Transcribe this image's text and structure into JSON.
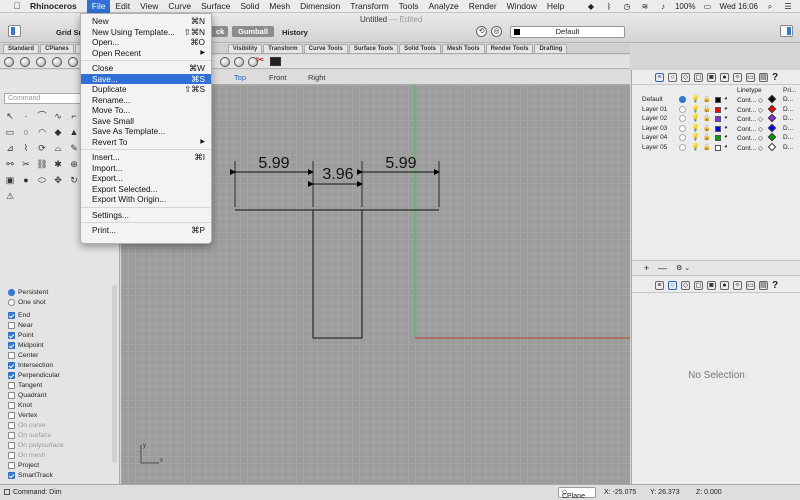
{
  "menubar": {
    "app": "Rhinoceros",
    "items": [
      "File",
      "Edit",
      "View",
      "Curve",
      "Surface",
      "Solid",
      "Mesh",
      "Dimension",
      "Transform",
      "Tools",
      "Analyze",
      "Render",
      "Window",
      "Help"
    ],
    "battery": "100%",
    "clock": "Wed 16:06"
  },
  "window": {
    "title": "Untitled",
    "edited": "— Edited",
    "grid_snap": "Grid Sn",
    "lock_label": "ck",
    "gumball": "Gumball",
    "history": "History",
    "layer": "Default"
  },
  "tabs": [
    "Standard",
    "CPlanes",
    "S",
    "Visibility",
    "Transform",
    "Curve Tools",
    "Surface Tools",
    "Solid Tools",
    "Mesh Tools",
    "Render Tools",
    "Drafting"
  ],
  "command": {
    "placeholder": "Command"
  },
  "viewport": {
    "tabs": [
      "Top",
      "Front",
      "Right"
    ],
    "active": "Top",
    "dimensions": [
      "5.99",
      "3.96",
      "5.99"
    ],
    "axis_y": "y",
    "axis_x": "x"
  },
  "file_menu": {
    "items": [
      {
        "label": "New",
        "shortcut": "⌘N"
      },
      {
        "label": "New Using Template...",
        "shortcut": "⇧⌘N"
      },
      {
        "label": "Open...",
        "shortcut": "⌘O"
      },
      {
        "label": "Open Recent",
        "submenu": "▶"
      },
      {
        "sep": true
      },
      {
        "label": "Close",
        "shortcut": "⌘W"
      },
      {
        "label": "Save...",
        "shortcut": "⌘S",
        "highlight": true
      },
      {
        "label": "Duplicate",
        "shortcut": "⇧⌘S"
      },
      {
        "label": "Rename..."
      },
      {
        "label": "Move To..."
      },
      {
        "label": "Save Small"
      },
      {
        "label": "Save As Template..."
      },
      {
        "label": "Revert To",
        "submenu": "▶"
      },
      {
        "sep": true
      },
      {
        "label": "Insert...",
        "shortcut": "⌘I"
      },
      {
        "label": "Import..."
      },
      {
        "label": "Export..."
      },
      {
        "label": "Export Selected..."
      },
      {
        "label": "Export With Origin..."
      },
      {
        "sep": true
      },
      {
        "label": "Settings..."
      },
      {
        "sep": true
      },
      {
        "label": "Print...",
        "shortcut": "⌘P"
      }
    ]
  },
  "osnap": {
    "mode": [
      {
        "label": "Persistent",
        "on": true
      },
      {
        "label": "One shot",
        "on": false
      }
    ],
    "items": [
      {
        "label": "End",
        "on": true
      },
      {
        "label": "Near",
        "on": false
      },
      {
        "label": "Point",
        "on": true
      },
      {
        "label": "Midpoint",
        "on": true
      },
      {
        "label": "Center",
        "on": false
      },
      {
        "label": "Intersection",
        "on": true
      },
      {
        "label": "Perpendicular",
        "on": true
      },
      {
        "label": "Tangent",
        "on": false
      },
      {
        "label": "Quadrant",
        "on": false
      },
      {
        "label": "Knot",
        "on": false
      },
      {
        "label": "Vertex",
        "on": false
      },
      {
        "label": "On curve",
        "on": false,
        "disabled": true
      },
      {
        "label": "On surface",
        "on": false,
        "disabled": true
      },
      {
        "label": "On polysurface",
        "on": false,
        "disabled": true
      },
      {
        "label": "On mesh",
        "on": false,
        "disabled": true
      },
      {
        "label": "Project",
        "on": false
      },
      {
        "label": "SmartTrack",
        "on": true
      }
    ]
  },
  "layers": {
    "headers": {
      "linetype": "Linetype",
      "print": "Pri..."
    },
    "rows": [
      {
        "name": "Default",
        "current": true,
        "color": "#000000",
        "linetype": "Cont... ◇",
        "print_color": "#000000",
        "print": "D..."
      },
      {
        "name": "Layer 01",
        "current": false,
        "color": "#ff0000",
        "linetype": "Cont... ◇",
        "print_color": "#ff0000",
        "print": "D..."
      },
      {
        "name": "Layer 02",
        "current": false,
        "color": "#8a2be2",
        "linetype": "Cont... ◇",
        "print_color": "#8a2be2",
        "print": "D..."
      },
      {
        "name": "Layer 03",
        "current": false,
        "color": "#0000ff",
        "linetype": "Cont... ◇",
        "print_color": "#0000ff",
        "print": "D..."
      },
      {
        "name": "Layer 04",
        "current": false,
        "color": "#00a000",
        "linetype": "Cont... ◇",
        "print_color": "#00a000",
        "print": "D..."
      },
      {
        "name": "Layer 05",
        "current": false,
        "color": "#ffffff",
        "linetype": "Cont... ◇",
        "print_color": "#ffffff",
        "print": "D..."
      }
    ],
    "add_label": "+",
    "remove_label": "—",
    "gear_label": "⚙ ⌄"
  },
  "properties": {
    "empty": "No Selection"
  },
  "status": {
    "command": "Command: Dim",
    "cplane": "CPlane",
    "x": "X: -25.075",
    "y": "Y: 26.373",
    "z": "Z: 0.000"
  },
  "colors": {
    "accent": "#2f6fd6",
    "grid_bg": "#9c9c9c",
    "x_axis": "#c0392b",
    "y_axis": "#2ecc40"
  }
}
